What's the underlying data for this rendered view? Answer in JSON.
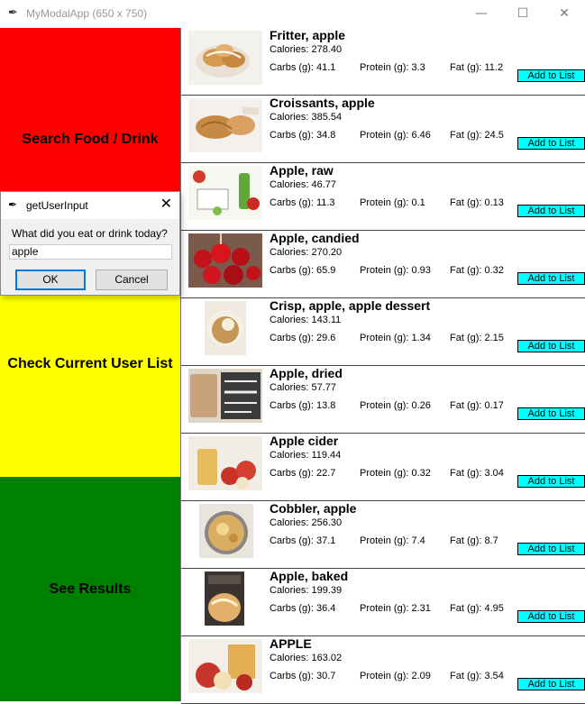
{
  "window": {
    "title": "MyModalApp (650 x 750)",
    "icon": "feather-icon"
  },
  "window_controls": {
    "minimize": "—",
    "maximize": "☐",
    "close": "✕"
  },
  "sidebar": [
    {
      "label": "Search Food / Drink",
      "color": "#ff0000"
    },
    {
      "label": "Check Current User List",
      "color": "#ffff00"
    },
    {
      "label": "See Results",
      "color": "#008000"
    }
  ],
  "food_list": [
    {
      "name": "Fritter, apple",
      "calories": "Calories: 278.40",
      "carbs": "Carbs (g): 41.1",
      "protein": "Protein (g): 3.3",
      "fat": "Fat (g): 11.2",
      "button": "Add to List",
      "thumb": "fritter-image"
    },
    {
      "name": "Croissants, apple",
      "calories": "Calories: 385.54",
      "carbs": "Carbs (g): 34.8",
      "protein": "Protein (g): 6.46",
      "fat": "Fat (g): 24.5",
      "button": "Add to List",
      "thumb": "croissant-image"
    },
    {
      "name": "Apple, raw",
      "calories": "Calories: 46.77",
      "carbs": "Carbs (g): 11.3",
      "protein": "Protein (g): 0.1",
      "fat": "Fat (g): 0.13",
      "button": "Add to List",
      "thumb": "raw-apple-image"
    },
    {
      "name": "Apple, candied",
      "calories": "Calories: 270.20",
      "carbs": "Carbs (g): 65.9",
      "protein": "Protein (g): 0.93",
      "fat": "Fat (g): 0.32",
      "button": "Add to List",
      "thumb": "candied-apple-image"
    },
    {
      "name": "Crisp, apple, apple dessert",
      "calories": "Calories: 143.11",
      "carbs": "Carbs (g): 29.6",
      "protein": "Protein (g): 1.34",
      "fat": "Fat (g): 2.15",
      "button": "Add to List",
      "thumb": "apple-crisp-image"
    },
    {
      "name": "Apple, dried",
      "calories": "Calories: 57.77",
      "carbs": "Carbs (g): 13.8",
      "protein": "Protein (g): 0.26",
      "fat": "Fat (g): 0.17",
      "button": "Add to List",
      "thumb": "dried-apple-image"
    },
    {
      "name": "Apple cider",
      "calories": "Calories: 119.44",
      "carbs": "Carbs (g): 22.7",
      "protein": "Protein (g): 0.32",
      "fat": "Fat (g): 3.04",
      "button": "Add to List",
      "thumb": "apple-cider-image"
    },
    {
      "name": "Cobbler, apple",
      "calories": "Calories: 256.30",
      "carbs": "Carbs (g): 37.1",
      "protein": "Protein (g): 7.4",
      "fat": "Fat (g): 8.7",
      "button": "Add to List",
      "thumb": "cobbler-image"
    },
    {
      "name": "Apple, baked",
      "calories": "Calories: 199.39",
      "carbs": "Carbs (g): 36.4",
      "protein": "Protein (g): 2.31",
      "fat": "Fat (g): 4.95",
      "button": "Add to List",
      "thumb": "baked-apple-image"
    },
    {
      "name": "APPLE",
      "calories": "Calories: 163.02",
      "carbs": "Carbs (g): 30.7",
      "protein": "Protein (g): 2.09",
      "fat": "Fat (g): 3.54",
      "button": "Add to List",
      "thumb": "apple-image"
    }
  ],
  "dialog": {
    "title": "getUserInput",
    "close": "✕",
    "prompt": "What did you eat or drink today?",
    "input_value": "apple",
    "ok_label": "OK",
    "cancel_label": "Cancel"
  },
  "colors": {
    "button_bg": "#00ffff",
    "row_border": "#444444"
  }
}
